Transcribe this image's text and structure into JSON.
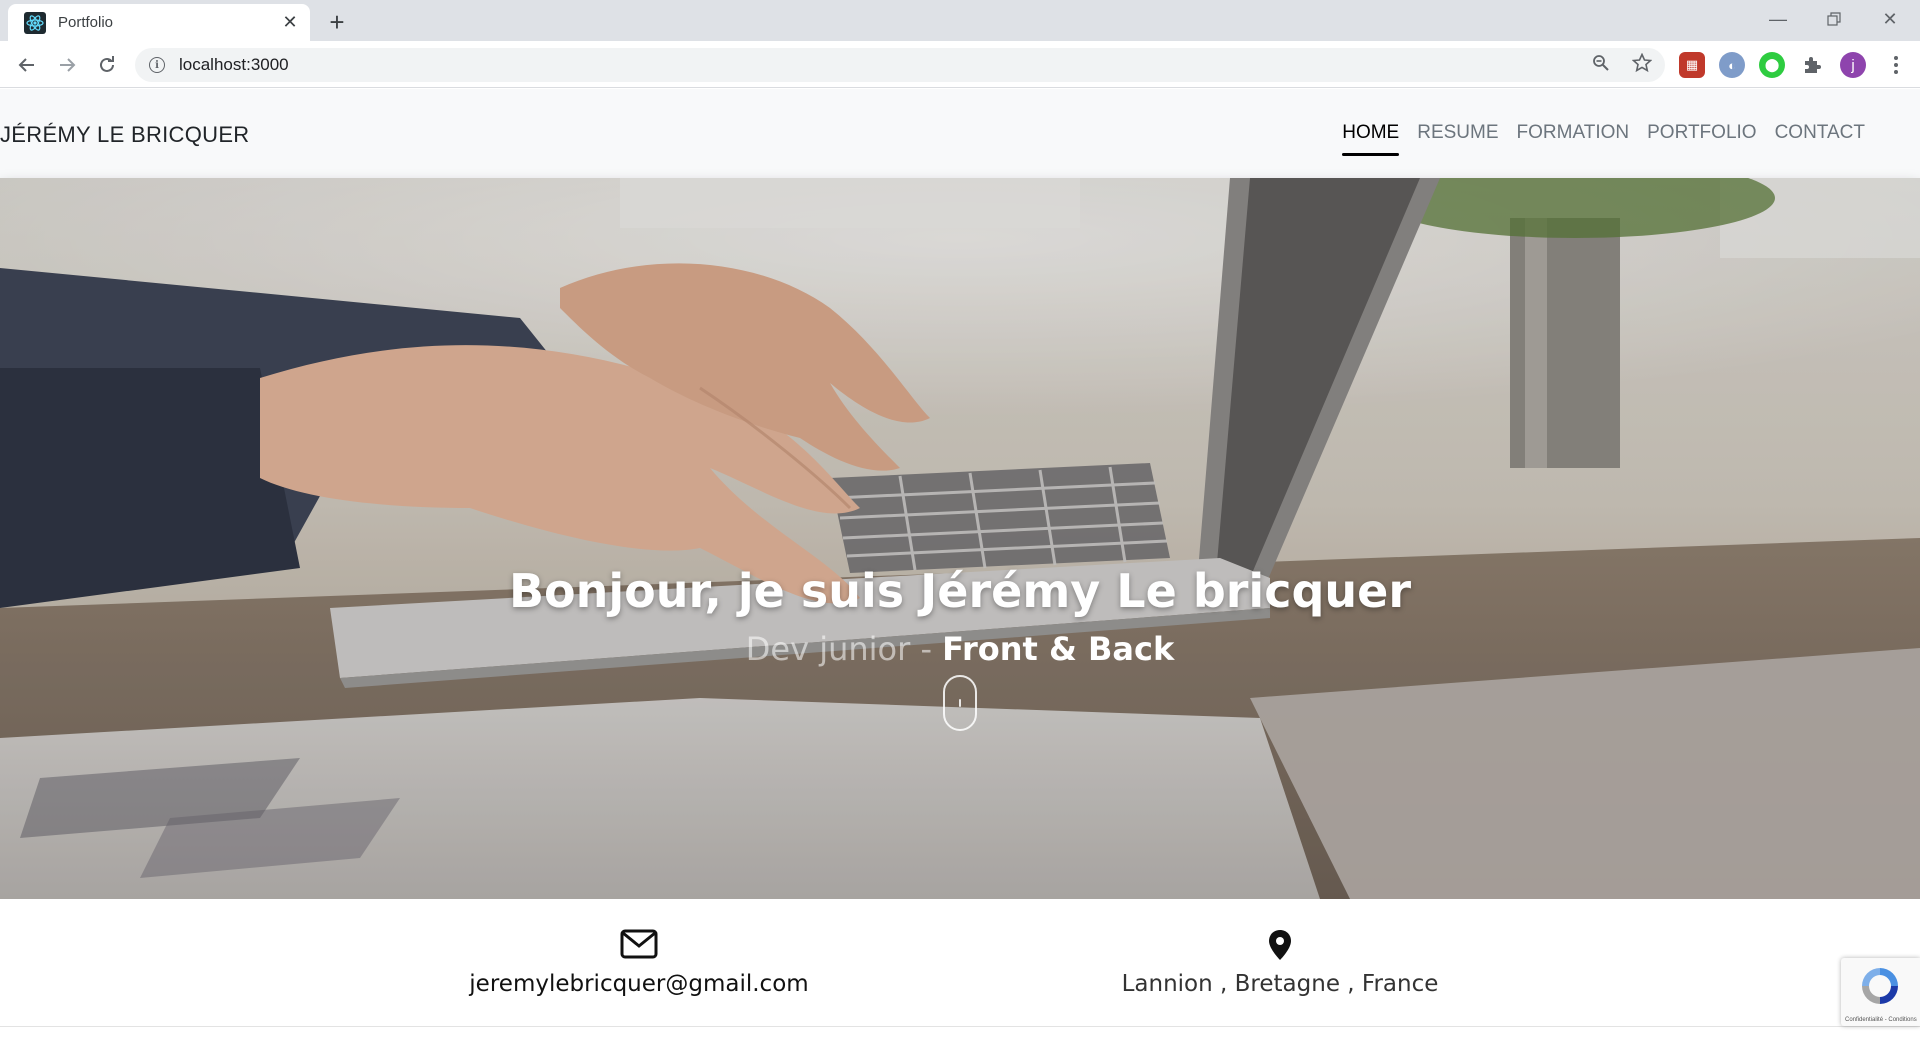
{
  "browser": {
    "tab_title": "Portfolio",
    "url": "localhost:3000",
    "profile_initial": "j"
  },
  "site": {
    "brand": "JÉRÉMY LE BRICQUER",
    "nav": [
      "HOME",
      "RESUME",
      "FORMATION",
      "PORTFOLIO",
      "CONTACT"
    ],
    "active_nav": "HOME"
  },
  "hero": {
    "title": "Bonjour, je suis Jérémy Le bricquer",
    "subtitle_dim": "Dev junior - ",
    "subtitle_bright": "Front & Back"
  },
  "contact": {
    "email": "jeremylebricquer@gmail.com",
    "location": "Lannion , Bretagne , France"
  },
  "recaptcha": {
    "legal": "Confidentialité - Conditions"
  },
  "colors": {
    "header_bg": "#f8f9fa",
    "chrome_bg": "#dee1e6",
    "nav_active": "#000000",
    "nav_inactive": "#6c757d"
  }
}
